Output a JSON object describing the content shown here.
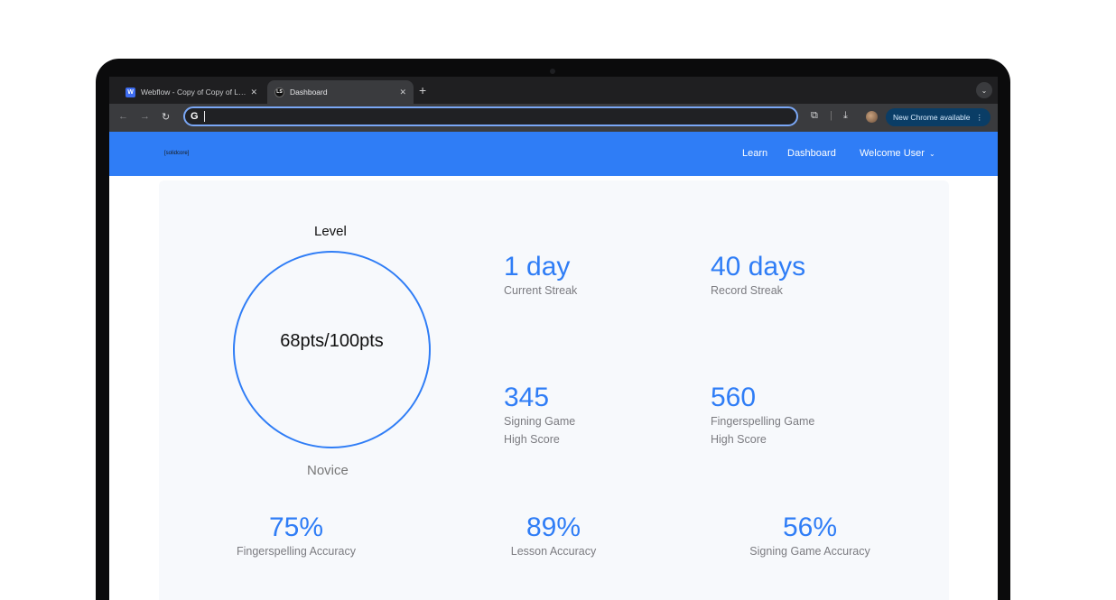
{
  "browser": {
    "tabs": [
      {
        "label": "Webflow - Copy of Copy of L…",
        "favicon": "webflow-icon",
        "active": false
      },
      {
        "label": "Dashboard",
        "favicon": "ls-icon",
        "active": true
      }
    ],
    "new_tab_symbol": "+",
    "address": "",
    "update_chip": "New Chrome available"
  },
  "site": {
    "logo": "[solidcore]",
    "nav": {
      "learn": "Learn",
      "dashboard": "Dashboard",
      "user": "Welcome User"
    }
  },
  "dashboard": {
    "level_title": "Level",
    "level_points": "68pts/100pts",
    "level_progress": 0.68,
    "level_name": "Novice",
    "stats": [
      {
        "value": "1 day",
        "label1": "Current Streak",
        "label2": ""
      },
      {
        "value": "40 days",
        "label1": "Record Streak",
        "label2": ""
      },
      {
        "value": "345",
        "label1": "Signing Game",
        "label2": "High Score"
      },
      {
        "value": "560",
        "label1": "Fingerspelling Game",
        "label2": "High Score"
      }
    ],
    "accuracy": [
      {
        "value": "75%",
        "label": "Fingerspelling Accuracy"
      },
      {
        "value": "89%",
        "label": "Lesson Accuracy"
      },
      {
        "value": "56%",
        "label": "Signing Game Accuracy"
      }
    ]
  },
  "colors": {
    "brand": "#2f7df6",
    "card_bg": "#f7f9fc",
    "muted_text": "#7b7b80"
  }
}
